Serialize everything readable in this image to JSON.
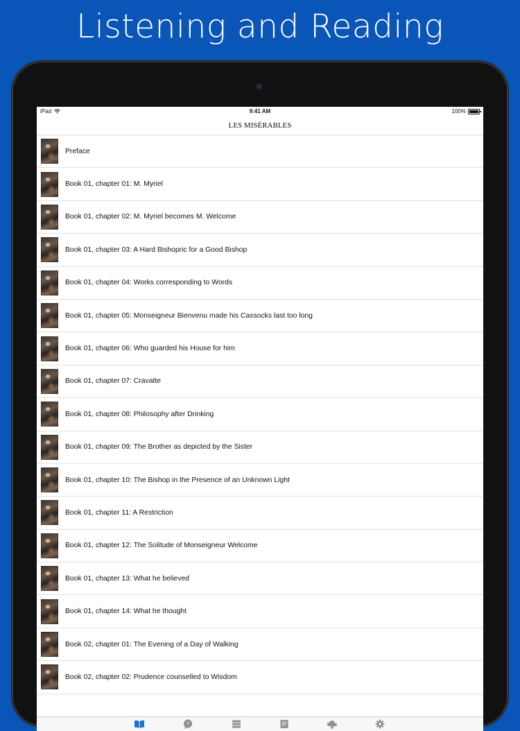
{
  "headline": "Listening and Reading",
  "status_bar": {
    "device": "iPad",
    "time": "9:41 AM",
    "battery": "100%"
  },
  "nav_title": "LES MISÉRABLES",
  "chapters": [
    "Preface",
    "Book 01, chapter 01: M. Myriel",
    "Book 01, chapter 02: M. Myriel becomes M. Welcome",
    "Book 01, chapter 03: A Hard Bishopric for a Good Bishop",
    "Book 01, chapter 04: Works corresponding to Words",
    "Book 01, chapter 05: Monseigneur Bienvenu made his Cassocks last too long",
    "Book 01, chapter 06: Who guarded his House for him",
    "Book 01, chapter 07: Cravatte",
    "Book 01, chapter 08: Philosophy after Drinking",
    "Book 01, chapter 09: The Brother as depicted by the Sister",
    "Book 01, chapter 10: The Bishop in the Presence of an Unknown Light",
    "Book 01, chapter 11: A Restriction",
    "Book 01, chapter 12: The Solitude of Monseigneur Welcome",
    "Book 01, chapter 13: What he believed",
    "Book 01, chapter 14: What he thought",
    "Book 02, chapter 01: The Evening of a Day of Walking",
    "Book 02, chapter 02: Prudence counselled to Wisdom"
  ],
  "tabs": [
    {
      "icon": "book-icon",
      "active": true
    },
    {
      "icon": "question-bubble-icon",
      "active": false
    },
    {
      "icon": "stack-icon",
      "active": false
    },
    {
      "icon": "notes-icon",
      "active": false
    },
    {
      "icon": "cloud-download-icon",
      "active": false
    },
    {
      "icon": "gear-icon",
      "active": false
    }
  ],
  "colors": {
    "background": "#0a55b8",
    "tab_active": "#1a73c9",
    "tab_inactive": "#8e8e93"
  }
}
